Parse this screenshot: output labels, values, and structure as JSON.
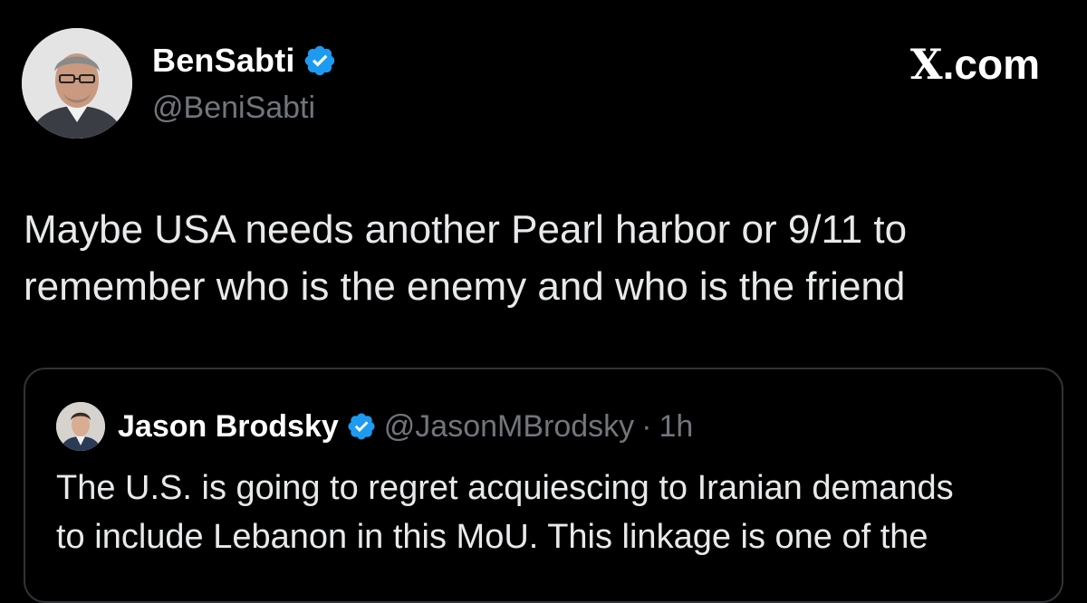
{
  "author": {
    "display_name": "BenSabti",
    "handle": "@BeniSabti",
    "verified": true,
    "avatar_icon": "profile-photo-icon"
  },
  "brand": {
    "text": ".com",
    "logo": "X"
  },
  "tweet": {
    "text_line1": "Maybe USA needs another Pearl harbor or 9/11 to",
    "text_line2": "remember who is the enemy and who is the friend"
  },
  "quote": {
    "display_name": "Jason Brodsky",
    "handle": "@JasonMBrodsky",
    "separator": "·",
    "time": "1h",
    "verified": true,
    "avatar_icon": "profile-photo-icon",
    "text_line1": "The U.S. is going to regret acquiescing to Iranian demands",
    "text_line2": "to include Lebanon in this MoU. This linkage is one of the"
  },
  "colors": {
    "background": "#000000",
    "primary_text": "#e7e9ea",
    "secondary_text": "#71767b",
    "verified_blue": "#1d9bf0",
    "card_border": "#2f3336"
  }
}
